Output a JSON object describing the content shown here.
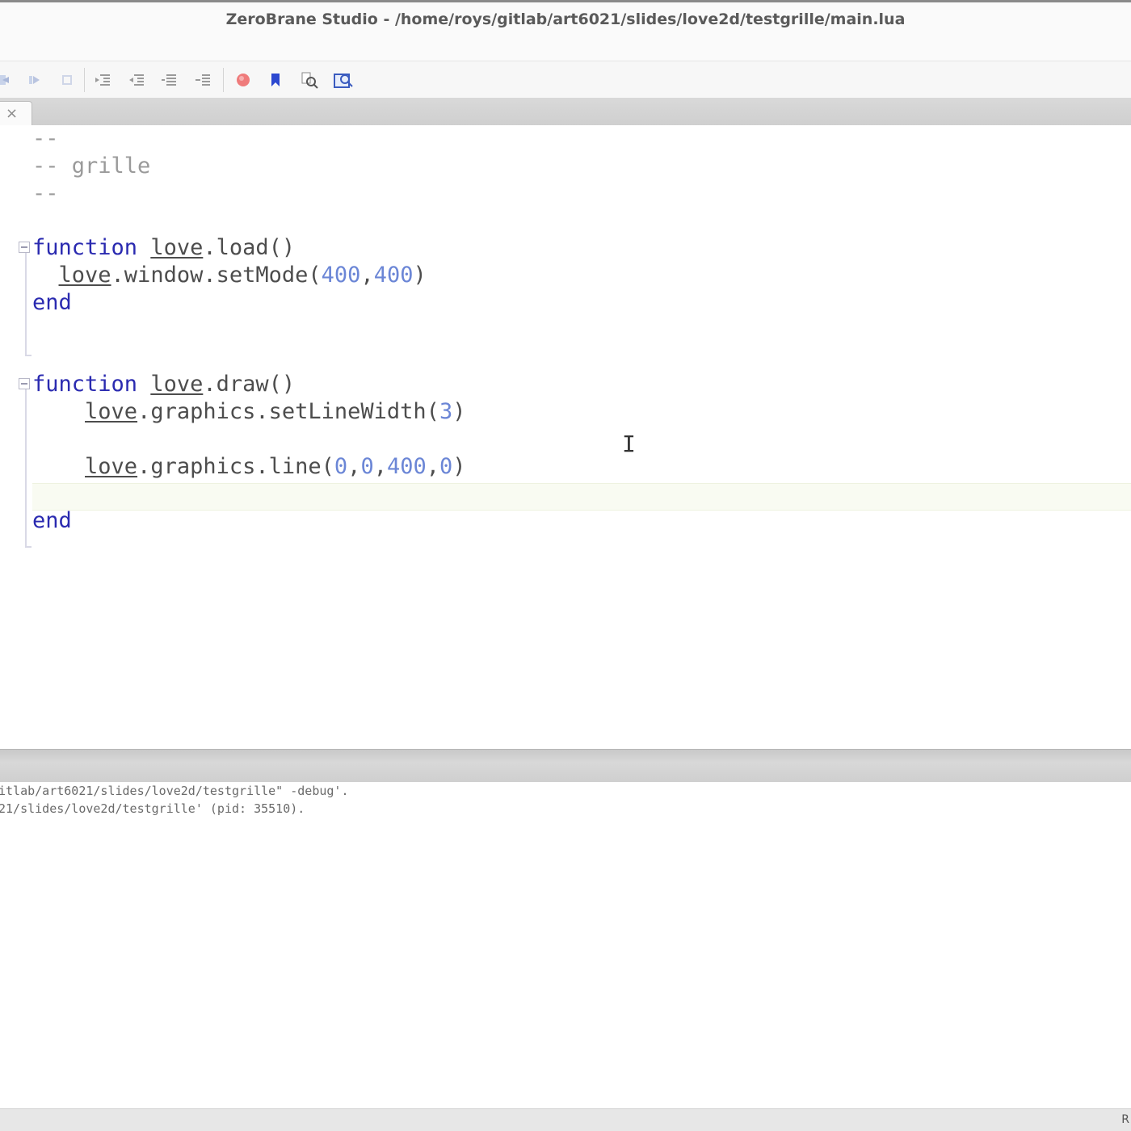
{
  "window": {
    "title": "ZeroBrane Studio - /home/roys/gitlab/art6021/slides/love2d/testgrille/main.lua"
  },
  "toolbar": {
    "buttons": [
      {
        "icon": "step-into-icon"
      },
      {
        "icon": "step-over-icon"
      },
      {
        "icon": "stop-icon"
      },
      {
        "icon": "indent-icon"
      },
      {
        "icon": "outdent-icon"
      },
      {
        "icon": "comment-icon"
      },
      {
        "icon": "uncomment-icon"
      },
      {
        "icon": "breakpoint-icon"
      },
      {
        "icon": "bookmark-icon"
      },
      {
        "icon": "find-icon"
      },
      {
        "icon": "replace-icon"
      }
    ]
  },
  "tabs": {
    "active_close": "×"
  },
  "editor": {
    "lines": [
      {
        "text": "--"
      },
      {
        "text": "-- grille"
      },
      {
        "text": "--"
      },
      {
        "text": ""
      },
      {
        "kw": "function",
        "obj": "love",
        "rest": ".load()"
      },
      {
        "indent": "  ",
        "obj": "love",
        "rest": ".window.setMode(",
        "n1": "400",
        "sep1": ",",
        "n2": "400",
        "end": ")"
      },
      {
        "kw": "end"
      },
      {
        "text": ""
      },
      {
        "text": ""
      },
      {
        "kw": "function",
        "obj": "love",
        "rest": ".draw()"
      },
      {
        "indent": "    ",
        "obj": "love",
        "rest": ".graphics.setLineWidth(",
        "n1": "3",
        "end": ")"
      },
      {
        "text": ""
      },
      {
        "indent": "    ",
        "obj": "love",
        "rest": ".graphics.line(",
        "n1": "0",
        "sep1": ",",
        "n2": "0",
        "sep2": ",",
        "n3": "400",
        "sep3": ",",
        "n4": "0",
        "end": ")"
      },
      {
        "text": ""
      },
      {
        "kw": "end"
      }
    ]
  },
  "output": {
    "lines": [
      "itlab/art6021/slides/love2d/testgrille\" -debug'.",
      "21/slides/love2d/testgrille' (pid: 35510)."
    ]
  },
  "statusbar": {
    "right_text": "R"
  },
  "colors": {
    "keyword": "#2a2ab0",
    "comment": "#9a9a9a",
    "number": "#6b86d6",
    "text": "#4d4d4d"
  }
}
